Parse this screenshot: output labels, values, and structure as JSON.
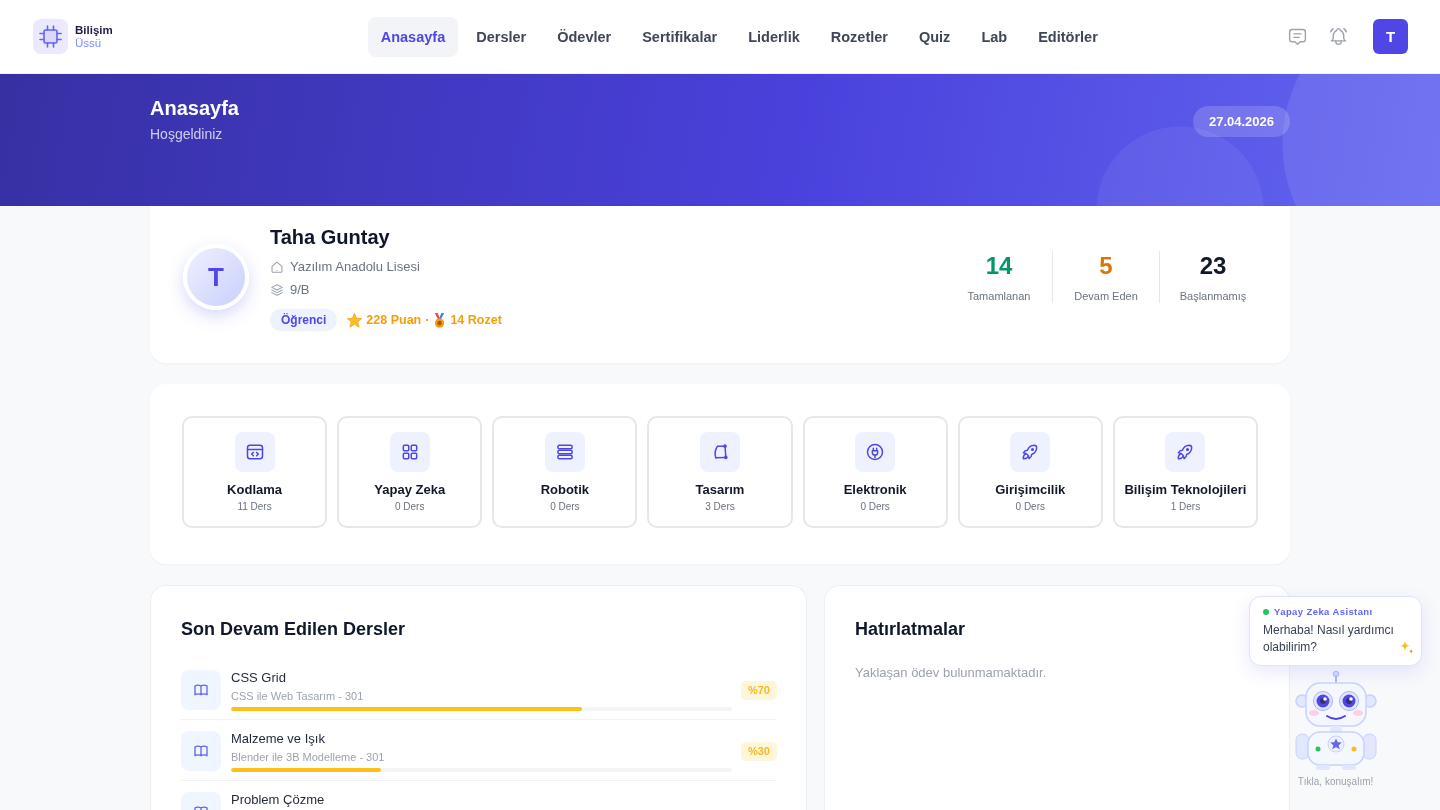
{
  "brand": {
    "name": "Bilişim",
    "subtitle": "Üssü"
  },
  "nav": [
    {
      "label": "Anasayfa",
      "selected": true
    },
    {
      "label": "Dersler",
      "selected": false
    },
    {
      "label": "Ödevler",
      "selected": false
    },
    {
      "label": "Sertifikalar",
      "selected": false
    },
    {
      "label": "Liderlik",
      "selected": false
    },
    {
      "label": "Rozetler",
      "selected": false
    },
    {
      "label": "Quiz",
      "selected": false
    },
    {
      "label": "Lab",
      "selected": false
    },
    {
      "label": "Editörler",
      "selected": false
    }
  ],
  "user_menu": {
    "avatar_letter": "T"
  },
  "hero": {
    "title": "Anasayfa",
    "subtitle": "Hoşgeldiniz",
    "date": "27.04.2026"
  },
  "profile": {
    "avatar_letter": "T",
    "name": "Taha Guntay",
    "school": "Yazılım Anadolu Lisesi",
    "class": "9/B",
    "role": "Öğrenci",
    "points": "228 Puan",
    "separator": "·",
    "badges": "14 Rozet"
  },
  "stats": [
    {
      "value": "14",
      "label": "Tamamlanan",
      "color": "#059669"
    },
    {
      "value": "5",
      "label": "Devam Eden",
      "color": "#d97706"
    },
    {
      "value": "23",
      "label": "Başlanmamış",
      "color": "#111827"
    }
  ],
  "categories": [
    {
      "name": "Kodlama",
      "count": "11 Ders"
    },
    {
      "name": "Yapay Zeka",
      "count": "0 Ders"
    },
    {
      "name": "Robotik",
      "count": "0 Ders"
    },
    {
      "name": "Tasarım",
      "count": "3 Ders"
    },
    {
      "name": "Elektronik",
      "count": "0 Ders"
    },
    {
      "name": "Girişimcilik",
      "count": "0 Ders"
    },
    {
      "name": "Bilişim Teknolojileri",
      "count": "1 Ders"
    }
  ],
  "recent_lessons": {
    "title": "Son Devam Edilen Dersler",
    "items": [
      {
        "title": "CSS Grid",
        "course": "CSS ile Web Tasarım - 301",
        "level": 0.7,
        "percent": "%70"
      },
      {
        "title": "Malzeme ve Işık",
        "course": "Blender ile 3B Modelleme - 301",
        "level": 0.3,
        "percent": "%30"
      },
      {
        "title": "Problem Çözme"
      }
    ]
  },
  "reminders": {
    "title": "Hatırlatmalar",
    "empty_text": "Yaklaşan ödev bulunmamaktadır."
  },
  "assistant": {
    "name": "Yapay Zeka Asistanı",
    "online": true,
    "message": "Merhaba! Nasıl yardımcı olabilirim?",
    "hint": "Tıkla, konuşalım!"
  }
}
